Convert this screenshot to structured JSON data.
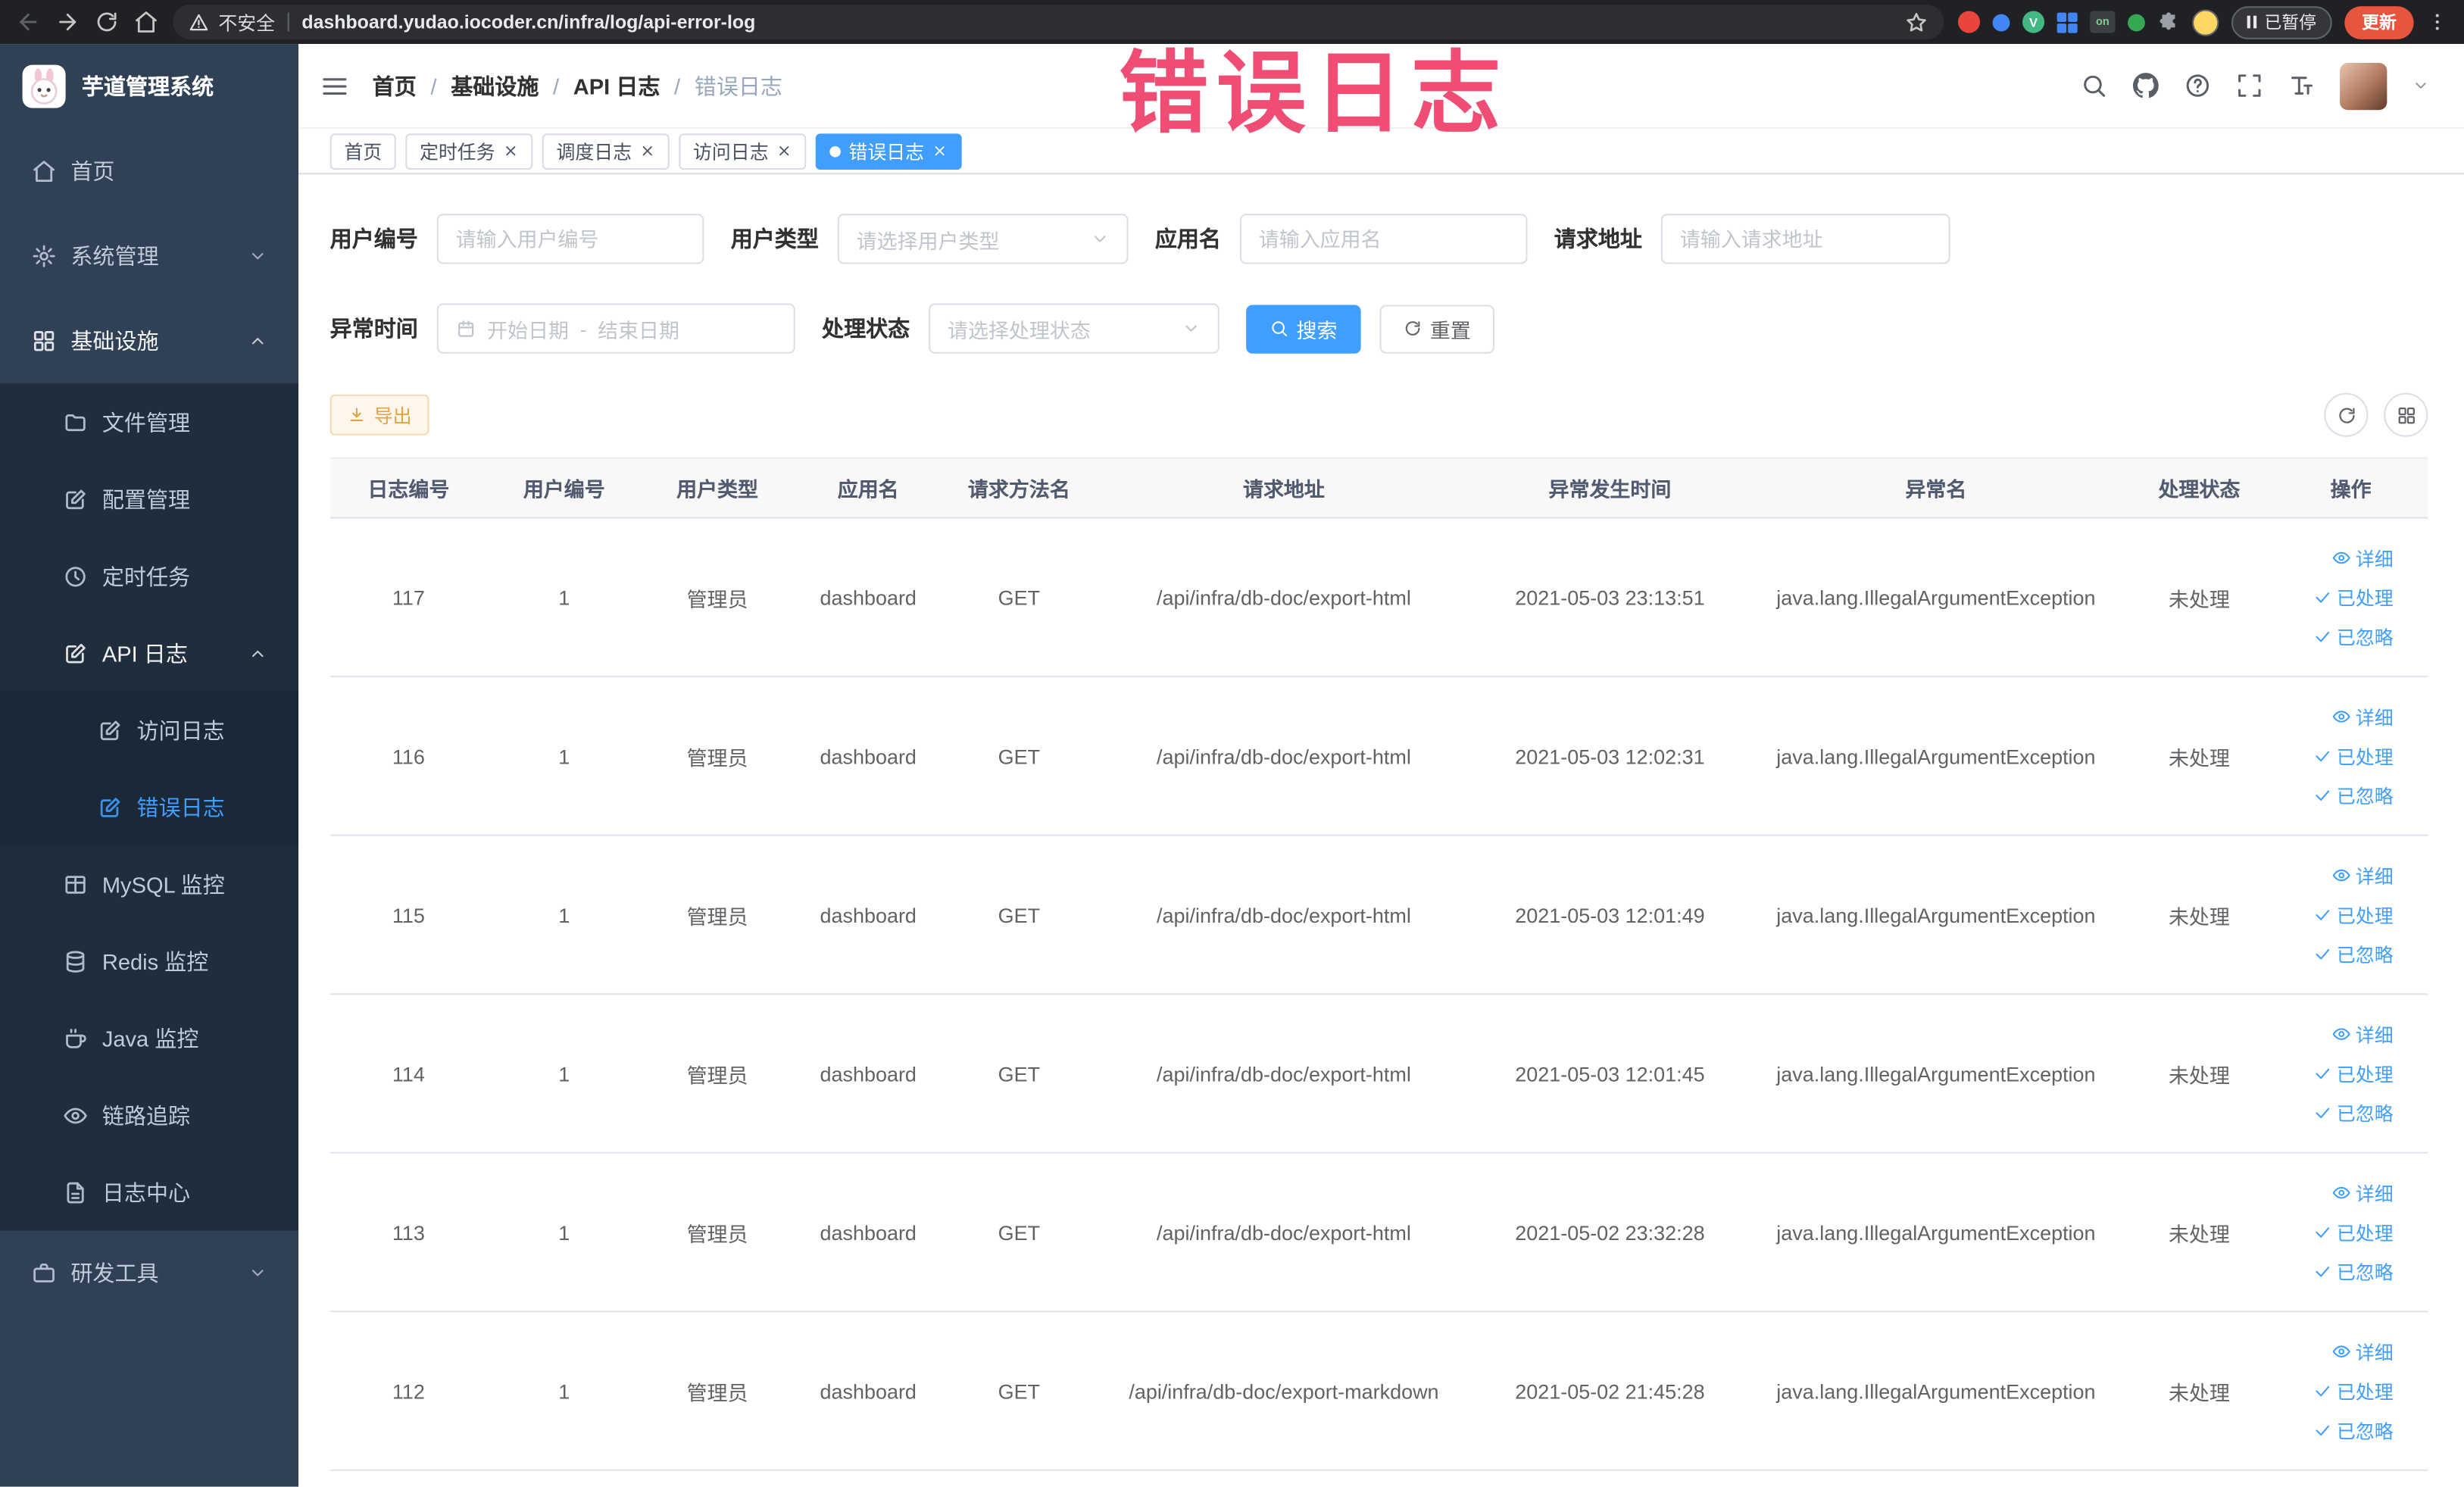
{
  "browser": {
    "security_label": "不安全",
    "url": "dashboard.yudao.iocoder.cn/infra/log/api-error-log",
    "extension_badge": "on",
    "paused_button": "已暂停",
    "update_button": "更新"
  },
  "annotation": "错误日志",
  "sidebar": {
    "logo_title": "芋道管理系统",
    "items": [
      {
        "label": "首页"
      },
      {
        "label": "系统管理"
      },
      {
        "label": "基础设施"
      },
      {
        "label": "文件管理"
      },
      {
        "label": "配置管理"
      },
      {
        "label": "定时任务"
      },
      {
        "label": "API 日志"
      },
      {
        "label": "访问日志"
      },
      {
        "label": "错误日志"
      },
      {
        "label": "MySQL 监控"
      },
      {
        "label": "Redis 监控"
      },
      {
        "label": "Java 监控"
      },
      {
        "label": "链路追踪"
      },
      {
        "label": "日志中心"
      },
      {
        "label": "研发工具"
      }
    ]
  },
  "breadcrumb": {
    "items": [
      "首页",
      "基础设施",
      "API 日志",
      "错误日志"
    ]
  },
  "tabs": [
    {
      "label": "首页"
    },
    {
      "label": "定时任务"
    },
    {
      "label": "调度日志"
    },
    {
      "label": "访问日志"
    },
    {
      "label": "错误日志"
    }
  ],
  "filters": {
    "user_id": {
      "label": "用户编号",
      "placeholder": "请输入用户编号"
    },
    "user_type": {
      "label": "用户类型",
      "placeholder": "请选择用户类型"
    },
    "app_name": {
      "label": "应用名",
      "placeholder": "请输入应用名"
    },
    "request_url": {
      "label": "请求地址",
      "placeholder": "请输入请求地址"
    },
    "exception_time": {
      "label": "异常时间",
      "start_placeholder": "开始日期",
      "separator": "-",
      "end_placeholder": "结束日期"
    },
    "process_status": {
      "label": "处理状态",
      "placeholder": "请选择处理状态"
    },
    "search_button": "搜索",
    "reset_button": "重置"
  },
  "toolbar": {
    "export_button": "导出"
  },
  "table": {
    "columns": [
      "日志编号",
      "用户编号",
      "用户类型",
      "应用名",
      "请求方法名",
      "请求地址",
      "异常发生时间",
      "异常名",
      "处理状态",
      "操作"
    ],
    "actions": {
      "detail": "详细",
      "processed": "已处理",
      "ignored": "已忽略"
    },
    "rows": [
      {
        "id": "117",
        "user_id": "1",
        "user_type": "管理员",
        "app": "dashboard",
        "method": "GET",
        "url": "/api/infra/db-doc/export-html",
        "time": "2021-05-03 23:13:51",
        "exception": "java.lang.IllegalArgumentException",
        "status": "未处理"
      },
      {
        "id": "116",
        "user_id": "1",
        "user_type": "管理员",
        "app": "dashboard",
        "method": "GET",
        "url": "/api/infra/db-doc/export-html",
        "time": "2021-05-03 12:02:31",
        "exception": "java.lang.IllegalArgumentException",
        "status": "未处理"
      },
      {
        "id": "115",
        "user_id": "1",
        "user_type": "管理员",
        "app": "dashboard",
        "method": "GET",
        "url": "/api/infra/db-doc/export-html",
        "time": "2021-05-03 12:01:49",
        "exception": "java.lang.IllegalArgumentException",
        "status": "未处理"
      },
      {
        "id": "114",
        "user_id": "1",
        "user_type": "管理员",
        "app": "dashboard",
        "method": "GET",
        "url": "/api/infra/db-doc/export-html",
        "time": "2021-05-03 12:01:45",
        "exception": "java.lang.IllegalArgumentException",
        "status": "未处理"
      },
      {
        "id": "113",
        "user_id": "1",
        "user_type": "管理员",
        "app": "dashboard",
        "method": "GET",
        "url": "/api/infra/db-doc/export-html",
        "time": "2021-05-02 23:32:28",
        "exception": "java.lang.IllegalArgumentException",
        "status": "未处理"
      },
      {
        "id": "112",
        "user_id": "1",
        "user_type": "管理员",
        "app": "dashboard",
        "method": "GET",
        "url": "/api/infra/db-doc/export-markdown",
        "time": "2021-05-02 21:45:28",
        "exception": "java.lang.IllegalArgumentException",
        "status": "未处理"
      }
    ]
  },
  "colors": {
    "accent": "#409eff",
    "annotation": "#ef4d73",
    "warning": "#e6a23c",
    "sidebar_bg": "#304156",
    "sidebar_sub_bg": "#1f2d3d",
    "active_tab_bg": "#409eff"
  }
}
